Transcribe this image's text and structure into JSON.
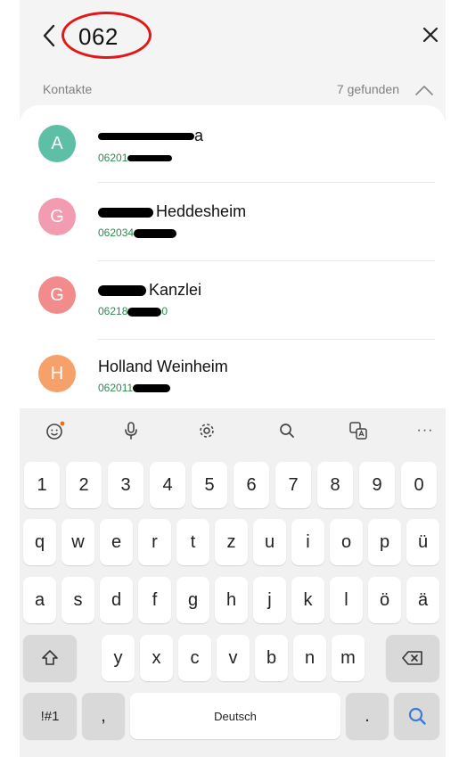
{
  "header": {
    "search_query": "062",
    "back_icon": "chevron-left",
    "close_icon": "x"
  },
  "section": {
    "label": "Kontakte",
    "found": "7 gefunden",
    "collapse_icon": "chevron-up"
  },
  "contacts": [
    {
      "initial": "A",
      "name_visible": "a",
      "number_visible": "06201",
      "avatar_color": "#5dbfa6"
    },
    {
      "initial": "G",
      "name_visible": "Heddesheim",
      "number_visible": "062034",
      "avatar_color": "#f29bb1"
    },
    {
      "initial": "G",
      "name_visible": "Kanzlei",
      "number_visible": "06218",
      "number_suffix": "0",
      "avatar_color": "#f28c8c"
    },
    {
      "initial": "H",
      "name_visible": "Holland  Weinheim",
      "number_visible": "062011",
      "avatar_color": "#f6a06a"
    }
  ],
  "toolbar": {
    "icons": [
      "emoji-icon",
      "microphone-icon",
      "settings-icon",
      "search-icon",
      "translate-icon",
      "more-icon"
    ],
    "more_label": "···"
  },
  "keyboard": {
    "row_numbers": [
      "1",
      "2",
      "3",
      "4",
      "5",
      "6",
      "7",
      "8",
      "9",
      "0"
    ],
    "row_top": [
      "q",
      "w",
      "e",
      "r",
      "t",
      "z",
      "u",
      "i",
      "o",
      "p",
      "ü"
    ],
    "row_mid": [
      "a",
      "s",
      "d",
      "f",
      "g",
      "h",
      "j",
      "k",
      "l",
      "ö",
      "ä"
    ],
    "row_bottom": [
      "y",
      "x",
      "c",
      "v",
      "b",
      "n",
      "m"
    ],
    "symbols_label": "!#1",
    "comma_label": ",",
    "space_label": "Deutsch",
    "period_label": ".",
    "accent_color": "#3a7bd5",
    "notification_dot_color": "#f26a1b"
  }
}
